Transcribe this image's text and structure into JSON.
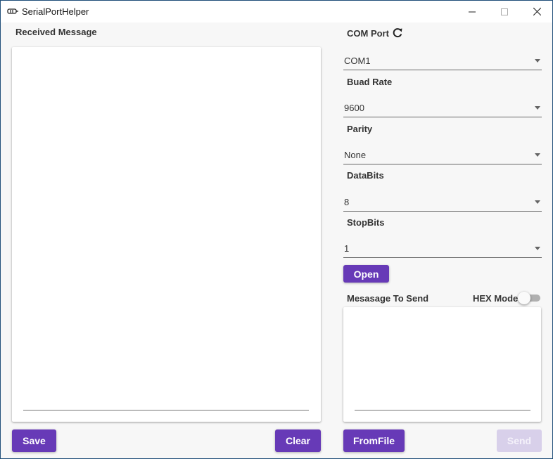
{
  "window": {
    "title": "SerialPortHelper",
    "controls": {
      "minimize": "minimize-icon",
      "maximize": "maximize-icon",
      "close": "close-icon"
    }
  },
  "received": {
    "label": "Received Message",
    "text": "",
    "save_label": "Save",
    "clear_label": "Clear"
  },
  "settings": {
    "com_port_label": "COM Port",
    "com_port_value": "COM1",
    "baud_rate_label": "Buad Rate",
    "baud_rate_value": "9600",
    "parity_label": "Parity",
    "parity_value": "None",
    "databits_label": "DataBits",
    "databits_value": "8",
    "stopbits_label": "StopBits",
    "stopbits_value": "1",
    "open_label": "Open"
  },
  "send": {
    "label": "Mesasage To Send",
    "hex_mode_label": "HEX Mode",
    "hex_mode_on": false,
    "text": "",
    "fromfile_label": "FromFile",
    "send_label": "Send",
    "send_enabled": false
  },
  "colors": {
    "accent": "#673ab7",
    "accent_disabled": "#d8d0ea",
    "window_border": "#1f4e79"
  }
}
